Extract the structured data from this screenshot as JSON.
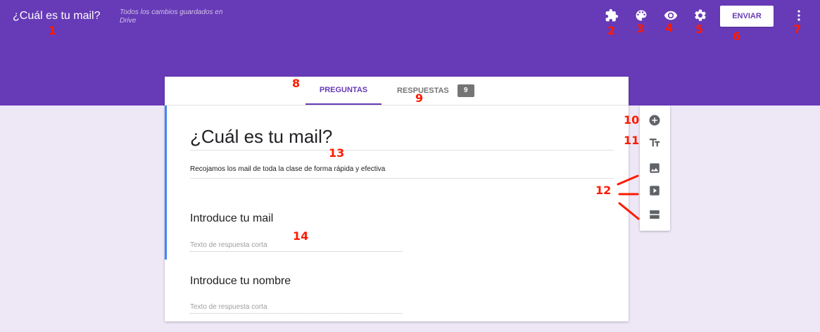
{
  "header": {
    "title": "¿Cuál es tu mail?",
    "save_status": "Todos los cambios guardados en Drive",
    "send_label": "ENVIAR",
    "icons": [
      "addons-icon",
      "palette-icon",
      "preview-eye-icon",
      "settings-gear-icon",
      "more-vert-icon"
    ],
    "bg_color": "#673ab7"
  },
  "tabs": {
    "preguntas": "PREGUNTAS",
    "respuestas": "RESPUESTAS",
    "respuestas_count": "9"
  },
  "form": {
    "title": "¿Cuál es tu mail?",
    "description": "Recojamos los mail de toda la clase de forma rápida y efectiva",
    "questions": [
      {
        "title": "Introduce tu mail",
        "placeholder": "Texto de respuesta corta"
      },
      {
        "title": "Introduce tu nombre",
        "placeholder": "Texto de respuesta corta"
      }
    ]
  },
  "side_toolbar": {
    "icons": [
      "add-question-icon",
      "add-title-icon",
      "add-image-icon",
      "add-video-icon",
      "add-section-icon"
    ]
  },
  "annotations": [
    "1",
    "2",
    "3",
    "4",
    "5",
    "6",
    "7",
    "8",
    "9",
    "10",
    "11",
    "12",
    "13",
    "14"
  ],
  "colors": {
    "accent": "#673ab7",
    "background": "#ede7f6",
    "annotation": "#ff1a00",
    "active_bar": "#4285f4"
  }
}
